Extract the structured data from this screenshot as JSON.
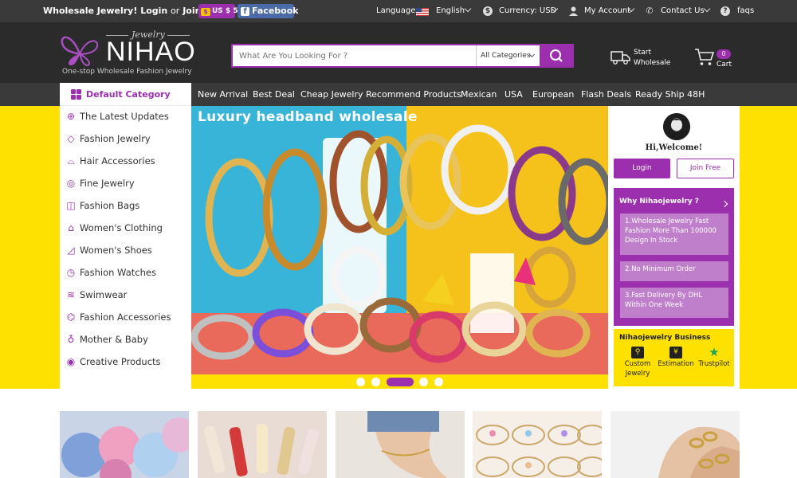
{
  "topbar": {
    "promo_bold": "Wholesale Jewelry!",
    "login": "Login",
    "or": "or",
    "join": "Join Free",
    "coupon_icon": "$",
    "coupon": "US $ 5",
    "facebook_icon": "f",
    "facebook": "Facebook",
    "languages_label": "Languages:",
    "language": "English",
    "currency": "Currency: USD",
    "account": "My Account",
    "contact": "Contact Us",
    "faqs": "faqs",
    "faq_icon": "?",
    "currency_icon": "$",
    "contact_icon": "✆"
  },
  "header": {
    "logo_script": "Jewelry",
    "logo_name": "NIHAO",
    "tagline": "One-stop Wholesale Fashion Jewelry",
    "search_placeholder": "What Are You Looking For ?",
    "category_select": "All Categories",
    "start_line1": "Start",
    "start_line2": "Wholesale",
    "cart_count": "0",
    "cart_label": "Cart"
  },
  "nav": {
    "default_category": "Default Category",
    "items": [
      "New Arrival",
      "Best Deal",
      "Cheap Jewelry",
      "Recommend Products",
      "Mexican",
      "USA",
      "European",
      "Flash Deals",
      "Ready Ship 48H"
    ]
  },
  "sidebar": {
    "items": [
      {
        "label": "The Latest Updates",
        "icon": "arrow-up-circle-icon",
        "glyph": "⊕"
      },
      {
        "label": "Fashion Jewelry",
        "icon": "diamond-icon",
        "glyph": "◇"
      },
      {
        "label": "Hair Accessories",
        "icon": "hair-accessory-icon",
        "glyph": "⌓"
      },
      {
        "label": "Fine Jewelry",
        "icon": "ring-icon",
        "glyph": "◎"
      },
      {
        "label": "Fashion Bags",
        "icon": "bag-icon",
        "glyph": "◫"
      },
      {
        "label": "Women's Clothing",
        "icon": "clothing-icon",
        "glyph": "⌂"
      },
      {
        "label": "Women's Shoes",
        "icon": "shoe-icon",
        "glyph": "◿"
      },
      {
        "label": "Fashion Watches",
        "icon": "watch-icon",
        "glyph": "◷"
      },
      {
        "label": "Swimwear",
        "icon": "swimwear-icon",
        "glyph": "≋"
      },
      {
        "label": "Fashion Accessories",
        "icon": "accessory-icon",
        "glyph": "⌬"
      },
      {
        "label": "Mother & Baby",
        "icon": "baby-stroller-icon",
        "glyph": "♁"
      },
      {
        "label": "Creative Products",
        "icon": "lightbulb-icon",
        "glyph": "◉"
      }
    ]
  },
  "banner": {
    "title": "Luxury headband wholesale",
    "active_slide": 3,
    "slide_count": 5
  },
  "account_panel": {
    "welcome": "Hi,Welcome!",
    "login": "Login",
    "join": "Join Free"
  },
  "why": {
    "title": "Why Nihaojewelry",
    "question_mark": "?",
    "points": [
      "1.Wholesale Jewelry Fast Fashion More Than 100000 Design In Stock",
      "2.No Minimum Order",
      "3.Fast Delivery By DHL Within One Week"
    ]
  },
  "business": {
    "title": "Nihaojewelry Business",
    "items": [
      {
        "label": "Custom Jewelry",
        "icon": "custom-jewelry-icon",
        "glyph": "⚲"
      },
      {
        "label": "Estimation",
        "icon": "estimation-icon",
        "glyph": "¥"
      },
      {
        "label": "Trustpilot",
        "icon": "trustpilot-star-icon",
        "glyph": "★"
      }
    ]
  },
  "colors": {
    "brand_purple": "#9b2fae",
    "banner_yellow": "#ffe100",
    "header_dark": "#2b2b2b",
    "nav_dark": "#3a3a3a"
  }
}
